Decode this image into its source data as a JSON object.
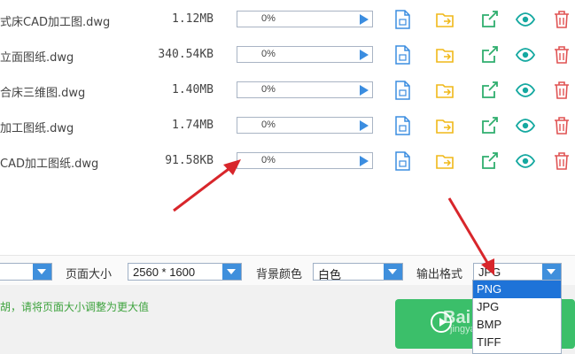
{
  "files": [
    {
      "name": "式床CAD加工图.dwg",
      "size": "1.12MB",
      "progress": "0%"
    },
    {
      "name": "立面图纸.dwg",
      "size": "340.54KB",
      "progress": "0%"
    },
    {
      "name": "合床三维图.dwg",
      "size": "1.40MB",
      "progress": "0%"
    },
    {
      "name": "加工图纸.dwg",
      "size": "1.74MB",
      "progress": "0%"
    },
    {
      "name": "CAD加工图纸.dwg",
      "size": "91.58KB",
      "progress": "0%"
    }
  ],
  "icons": {
    "doc": "document-icon",
    "folder": "folder-icon",
    "open": "external-open-icon",
    "preview": "eye-icon",
    "delete": "trash-icon"
  },
  "toolbar": {
    "page_size_label": "页面大小",
    "page_size_value": "2560 * 1600",
    "bg_color_label": "背景颜色",
    "bg_color_value": "白色",
    "output_format_label": "输出格式",
    "output_format_value": "JPG",
    "format_options": [
      "PNG",
      "JPG",
      "BMP",
      "TIFF"
    ],
    "highlighted_option": "PNG"
  },
  "footer": {
    "hint": "胡，请将页面大小调整为更大值"
  },
  "watermark": {
    "text": "Bai 经验",
    "url_text": "jingyan.baidu.com"
  },
  "colors": {
    "accent_blue": "#3f8fdc",
    "start_green": "#3bbf6a",
    "arrow_red": "#d8262b",
    "hint_green": "#3ea33e"
  }
}
